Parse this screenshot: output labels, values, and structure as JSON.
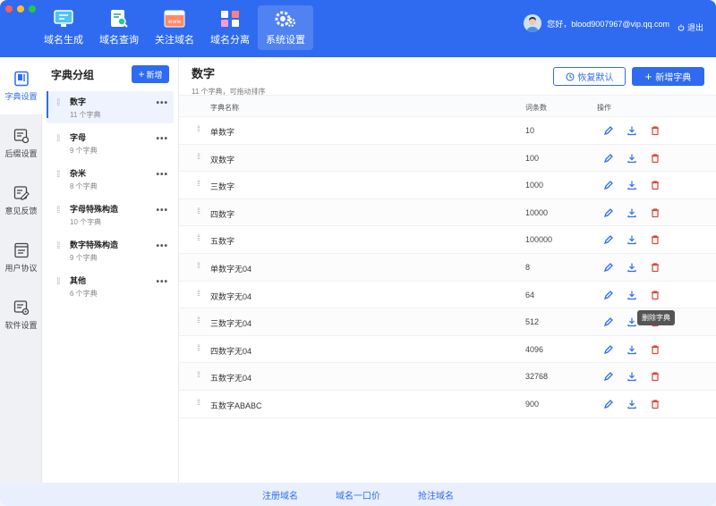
{
  "colors": {
    "accent": "#2f6bf0",
    "danger": "#e0443a",
    "close": "#ff5f57",
    "minimize": "#febc2e",
    "zoom": "#28c840"
  },
  "nav": [
    {
      "label": "域名生成",
      "icon": "monitor-icon"
    },
    {
      "label": "域名查询",
      "icon": "search-document-icon"
    },
    {
      "label": "关注域名",
      "icon": "www-icon"
    },
    {
      "label": "域名分离",
      "icon": "split-icon"
    },
    {
      "label": "系统设置",
      "icon": "gear-icon",
      "active": true
    }
  ],
  "user": {
    "greeting": "您好，blood9007967@vip.qq.com",
    "logout": "退出"
  },
  "rail": [
    {
      "label": "字典设置",
      "icon": "dictionary-icon",
      "active": true
    },
    {
      "label": "后缀设置",
      "icon": "suffix-settings-icon"
    },
    {
      "label": "意见反馈",
      "icon": "feedback-icon"
    },
    {
      "label": "用户协议",
      "icon": "agreement-icon"
    },
    {
      "label": "软件设置",
      "icon": "software-settings-icon"
    }
  ],
  "groups": {
    "title": "字典分组",
    "add_label": "新增",
    "items": [
      {
        "name": "数字",
        "count": "11 个字典",
        "active": true
      },
      {
        "name": "字母",
        "count": "9 个字典"
      },
      {
        "name": "杂米",
        "count": "8 个字典"
      },
      {
        "name": "字母特殊构造",
        "count": "10 个字典"
      },
      {
        "name": "数字特殊构造",
        "count": "9 个字典"
      },
      {
        "name": "其他",
        "count": "6 个字典"
      }
    ]
  },
  "main": {
    "title": "数字",
    "subtitle": "11 个字典，可拖动排序",
    "restore_label": "恢复默认",
    "new_label": "新增字典",
    "columns": {
      "name": "字典名称",
      "count": "词条数",
      "actions": "操作"
    },
    "rows": [
      {
        "name": "单数字",
        "count": "10"
      },
      {
        "name": "双数字",
        "count": "100"
      },
      {
        "name": "三数字",
        "count": "1000"
      },
      {
        "name": "四数字",
        "count": "10000"
      },
      {
        "name": "五数字",
        "count": "100000"
      },
      {
        "name": "单数字无04",
        "count": "8"
      },
      {
        "name": "双数字无04",
        "count": "64"
      },
      {
        "name": "三数字无04",
        "count": "512"
      },
      {
        "name": "四数字无04",
        "count": "4096"
      },
      {
        "name": "五数字无04",
        "count": "32768"
      },
      {
        "name": "五数字ABABC",
        "count": "900"
      }
    ],
    "tooltip": "删除字典"
  },
  "footer": [
    "注册域名",
    "域名一口价",
    "抢注域名"
  ]
}
